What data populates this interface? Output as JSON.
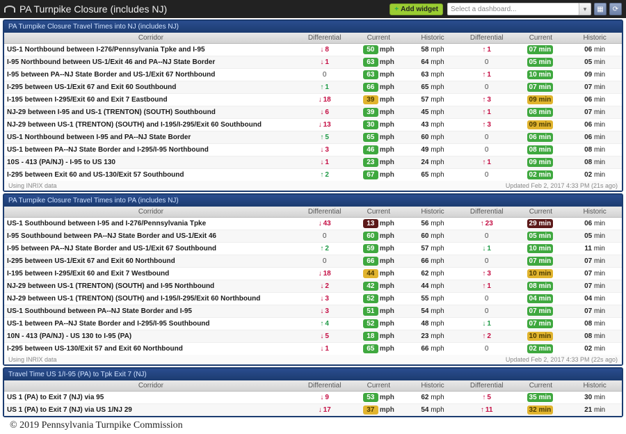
{
  "header": {
    "title": "PA Turnpike Closure (includes NJ)",
    "add_widget": "Add widget",
    "dash_placeholder": "Select a dashboard..."
  },
  "columns": [
    "Corridor",
    "Differential",
    "Current",
    "Historic",
    "Differential",
    "Current",
    "Historic"
  ],
  "speed_unit": "mph",
  "time_unit": "min",
  "panels": [
    {
      "title": "PA Turnpike Closure Travel Times into NJ (includes NJ)",
      "footer_left": "Using INRIX data",
      "footer_right": "Updated Feb 2, 2017 4:33 PM (21s ago)",
      "rows": [
        {
          "c": "US-1 Northbound between I-276/Pennsylvania Tpke and I-95",
          "d1": -8,
          "cs": 50,
          "csc": "g",
          "hs": 58,
          "d2": 1,
          "ct": "07",
          "ctc": "g",
          "ht": "06"
        },
        {
          "c": "I-95 Northbound between US-1/Exit 46 and PA--NJ State Border",
          "d1": -1,
          "cs": 63,
          "csc": "g",
          "hs": 64,
          "d2": 0,
          "ct": "05",
          "ctc": "g",
          "ht": "05"
        },
        {
          "c": "I-95 between PA--NJ State Border and US-1/Exit 67 Northbound",
          "d1": 0,
          "cs": 63,
          "csc": "g",
          "hs": 63,
          "d2": 1,
          "ct": "10",
          "ctc": "g",
          "ht": "09"
        },
        {
          "c": "I-295 between US-1/Exit 67 and Exit 60 Southbound",
          "d1": 1,
          "cs": 66,
          "csc": "g",
          "hs": 65,
          "d2": 0,
          "ct": "07",
          "ctc": "g",
          "ht": "07"
        },
        {
          "c": "I-195 between I-295/Exit 60 and Exit 7 Eastbound",
          "d1": -18,
          "cs": 39,
          "csc": "y",
          "hs": 57,
          "d2": 3,
          "ct": "09",
          "ctc": "y",
          "ht": "06"
        },
        {
          "c": "NJ-29 between I-95 and US-1 (TRENTON) (SOUTH) Southbound",
          "d1": -6,
          "cs": 39,
          "csc": "g",
          "hs": 45,
          "d2": 1,
          "ct": "08",
          "ctc": "g",
          "ht": "07"
        },
        {
          "c": "NJ-29 between US-1 (TRENTON) (SOUTH) and I-195/I-295/Exit 60 Southbound",
          "d1": -13,
          "cs": 30,
          "csc": "g",
          "hs": 43,
          "d2": 3,
          "ct": "09",
          "ctc": "y",
          "ht": "06"
        },
        {
          "c": "US-1 Northbound between I-95 and PA--NJ State Border",
          "d1": 5,
          "cs": 65,
          "csc": "g",
          "hs": 60,
          "d2": 0,
          "ct": "06",
          "ctc": "g",
          "ht": "06"
        },
        {
          "c": "US-1 between PA--NJ State Border and I-295/I-95 Northbound",
          "d1": -3,
          "cs": 46,
          "csc": "g",
          "hs": 49,
          "d2": 0,
          "ct": "08",
          "ctc": "g",
          "ht": "08"
        },
        {
          "c": "10S - 413 (PA/NJ) - I-95 to US 130",
          "d1": -1,
          "cs": 23,
          "csc": "g",
          "hs": 24,
          "d2": 1,
          "ct": "09",
          "ctc": "g",
          "ht": "08"
        },
        {
          "c": "I-295 between Exit 60 and US-130/Exit 57 Southbound",
          "d1": 2,
          "cs": 67,
          "csc": "g",
          "hs": 65,
          "d2": 0,
          "ct": "02",
          "ctc": "g",
          "ht": "02"
        }
      ]
    },
    {
      "title": "PA Turnpike Closure Travel Times into PA (includes NJ)",
      "footer_left": "Using INRIX data",
      "footer_right": "Updated Feb 2, 2017 4:33 PM (22s ago)",
      "rows": [
        {
          "c": "US-1 Southbound between I-95 and I-276/Pennsylvania Tpke",
          "d1": -43,
          "cs": 13,
          "csc": "dr",
          "hs": 56,
          "d2": 23,
          "ct": "29",
          "ctc": "dr",
          "ht": "06"
        },
        {
          "c": "I-95 Southbound between PA--NJ State Border and US-1/Exit 46",
          "d1": 0,
          "cs": 60,
          "csc": "g",
          "hs": 60,
          "d2": 0,
          "ct": "05",
          "ctc": "g",
          "ht": "05"
        },
        {
          "c": "I-95 between PA--NJ State Border and US-1/Exit 67 Southbound",
          "d1": 2,
          "cs": 59,
          "csc": "g",
          "hs": 57,
          "d2": -1,
          "ct": "10",
          "ctc": "g",
          "ht": "11"
        },
        {
          "c": "I-295 between US-1/Exit 67 and Exit 60 Northbound",
          "d1": 0,
          "cs": 66,
          "csc": "g",
          "hs": 66,
          "d2": 0,
          "ct": "07",
          "ctc": "g",
          "ht": "07"
        },
        {
          "c": "I-195 between I-295/Exit 60 and Exit 7 Westbound",
          "d1": -18,
          "cs": 44,
          "csc": "y",
          "hs": 62,
          "d2": 3,
          "ct": "10",
          "ctc": "y",
          "ht": "07"
        },
        {
          "c": "NJ-29 between US-1 (TRENTON) (SOUTH) and I-95 Northbound",
          "d1": -2,
          "cs": 42,
          "csc": "g",
          "hs": 44,
          "d2": 1,
          "ct": "08",
          "ctc": "g",
          "ht": "07"
        },
        {
          "c": "NJ-29 between US-1 (TRENTON) (SOUTH) and I-195/I-295/Exit 60 Northbound",
          "d1": -3,
          "cs": 52,
          "csc": "g",
          "hs": 55,
          "d2": 0,
          "ct": "04",
          "ctc": "g",
          "ht": "04"
        },
        {
          "c": "US-1 Southbound between PA--NJ State Border and I-95",
          "d1": -3,
          "cs": 51,
          "csc": "g",
          "hs": 54,
          "d2": 0,
          "ct": "07",
          "ctc": "g",
          "ht": "07"
        },
        {
          "c": "US-1 between PA--NJ State Border and I-295/I-95 Southbound",
          "d1": 4,
          "cs": 52,
          "csc": "g",
          "hs": 48,
          "d2": -1,
          "ct": "07",
          "ctc": "g",
          "ht": "08"
        },
        {
          "c": "10N - 413 (PA/NJ) - US 130 to I-95 (PA)",
          "d1": -5,
          "cs": 18,
          "csc": "g",
          "hs": 23,
          "d2": 2,
          "ct": "10",
          "ctc": "y",
          "ht": "08"
        },
        {
          "c": "I-295 between US-130/Exit 57 and Exit 60 Northbound",
          "d1": -1,
          "cs": 65,
          "csc": "g",
          "hs": 66,
          "d2": 0,
          "ct": "02",
          "ctc": "g",
          "ht": "02"
        }
      ]
    },
    {
      "title": "Travel Time US 1/I-95 (PA) to Tpk Exit 7 (NJ)",
      "rows": [
        {
          "c": "US 1 (PA) to Exit 7 (NJ) via 95",
          "d1": -9,
          "cs": 53,
          "csc": "g",
          "hs": 62,
          "d2": 5,
          "ct": "35",
          "ctc": "g",
          "ht": "30"
        },
        {
          "c": "US 1 (PA) to Exit 7 (NJ) via US 1/NJ 29",
          "d1": -17,
          "cs": 37,
          "csc": "y",
          "hs": 54,
          "d2": 11,
          "ct": "32",
          "ctc": "y",
          "ht": "21"
        }
      ]
    }
  ],
  "copyright": "© 2019 Pennsylvania Turnpike Commission"
}
